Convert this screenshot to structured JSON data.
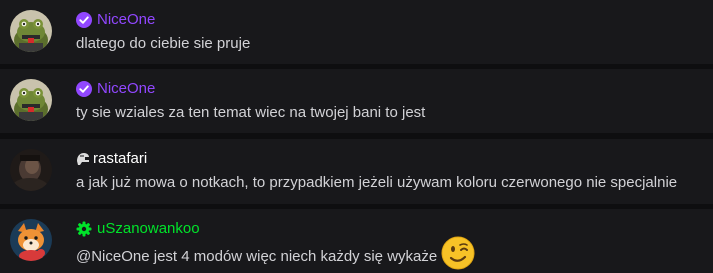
{
  "messages": [
    {
      "username": "NiceOne",
      "username_color": "#9147ff",
      "badge": "verified-badge-icon",
      "badge_color": "#9147ff",
      "avatar": "frog-avatar",
      "text": "dlatego do ciebie sie pruje"
    },
    {
      "username": "NiceOne",
      "username_color": "#9147ff",
      "badge": "verified-badge-icon",
      "badge_color": "#9147ff",
      "avatar": "frog-avatar",
      "text": "ty sie wziales za ten temat wiec na twojej bani to jest"
    },
    {
      "username": "rastafari",
      "username_color": "#ffffff",
      "badge": "helmet-icon",
      "badge_color": "#d9d9d9",
      "avatar": "dark-portrait-avatar",
      "text": "a jak już mowa o notkach, to przypadkiem jeżeli używam koloru czerwonego nie specjalnie"
    },
    {
      "username": "uSzanowankoo",
      "username_color": "#00e32a",
      "badge": "gear-badge-icon",
      "badge_color": "#00e32a",
      "avatar": "fox-avatar",
      "text": "@NiceOne jest 4 modów więc niech każdy się wykaże",
      "emoji": "winking-face-emoji"
    }
  ]
}
